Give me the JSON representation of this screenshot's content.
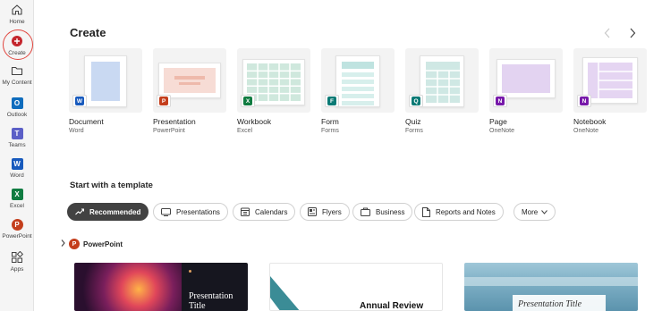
{
  "rail": {
    "items": [
      {
        "label": "Home",
        "icon": "home-icon"
      },
      {
        "label": "Create",
        "icon": "plus-circle-icon"
      },
      {
        "label": "My Content",
        "icon": "folder-icon"
      },
      {
        "label": "Outlook",
        "icon": "outlook-icon",
        "color": "#0f6cbd"
      },
      {
        "label": "Teams",
        "icon": "teams-icon",
        "color": "#5b5fc7"
      },
      {
        "label": "Word",
        "icon": "word-icon",
        "color": "#185abd"
      },
      {
        "label": "Excel",
        "icon": "excel-icon",
        "color": "#107c41"
      },
      {
        "label": "PowerPoint",
        "icon": "powerpoint-icon",
        "color": "#c43e1c"
      },
      {
        "label": "Apps",
        "icon": "apps-icon"
      }
    ]
  },
  "create": {
    "title": "Create",
    "prev_icon": "chevron-left-icon",
    "next_icon": "chevron-right-icon",
    "cards": [
      {
        "title": "Document",
        "app": "Word",
        "badge": "W",
        "color": "#185abd"
      },
      {
        "title": "Presentation",
        "app": "PowerPoint",
        "badge": "P",
        "color": "#c43e1c"
      },
      {
        "title": "Workbook",
        "app": "Excel",
        "badge": "X",
        "color": "#107c41"
      },
      {
        "title": "Form",
        "app": "Forms",
        "badge": "F",
        "color": "#0b7a75"
      },
      {
        "title": "Quiz",
        "app": "Forms",
        "badge": "Q",
        "color": "#0b7a75"
      },
      {
        "title": "Page",
        "app": "OneNote",
        "badge": "N",
        "color": "#7719aa"
      },
      {
        "title": "Notebook",
        "app": "OneNote",
        "badge": "N",
        "color": "#7719aa"
      }
    ]
  },
  "templates": {
    "title": "Start with a template",
    "chips": [
      {
        "label": "Recommended",
        "icon": "trending-icon",
        "active": true
      },
      {
        "label": "Presentations",
        "icon": "monitor-icon"
      },
      {
        "label": "Calendars",
        "icon": "calendar-icon"
      },
      {
        "label": "Flyers",
        "icon": "flyer-icon"
      },
      {
        "label": "Business",
        "icon": "briefcase-icon"
      },
      {
        "label": "Reports and Notes",
        "icon": "document-icon"
      },
      {
        "label": "More",
        "icon": "chevron-down-icon"
      }
    ],
    "group": {
      "label": "PowerPoint",
      "icon": "powerpoint-icon"
    },
    "items": [
      {
        "title_line1": "Presentation",
        "title_line2": "Title"
      },
      {
        "title": "Annual Review"
      },
      {
        "title": "Presentation Title"
      }
    ]
  }
}
